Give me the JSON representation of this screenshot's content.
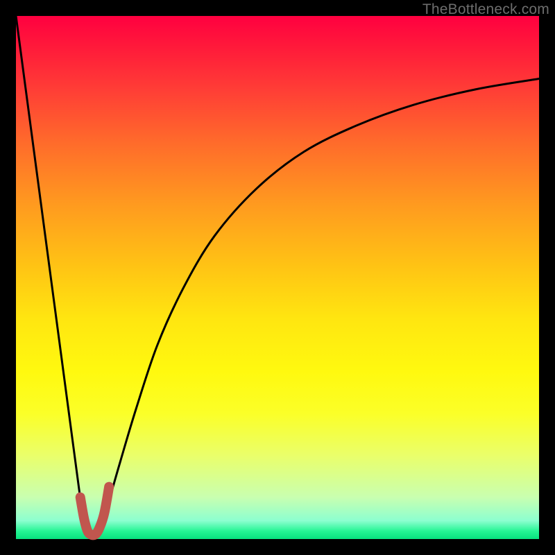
{
  "watermark": "TheBottleneck.com",
  "chart_data": {
    "type": "line",
    "title": "",
    "xlabel": "",
    "ylabel": "",
    "xlim": [
      0,
      100
    ],
    "ylim": [
      0,
      100
    ],
    "series": [
      {
        "name": "bottleneck-curve",
        "x": [
          0,
          12,
          13,
          14,
          15,
          16,
          17,
          18,
          20,
          23,
          27,
          32,
          38,
          46,
          55,
          65,
          76,
          88,
          100
        ],
        "values": [
          100,
          10,
          3,
          1,
          1,
          2,
          4,
          8,
          15,
          25,
          37,
          48,
          58,
          67,
          74,
          79,
          83,
          86,
          88
        ]
      },
      {
        "name": "recommended-range",
        "x": [
          12.3,
          13.0,
          13.7,
          14.5,
          15.3,
          16.0,
          16.9,
          17.8
        ],
        "values": [
          8.0,
          4.0,
          1.5,
          0.8,
          1.0,
          2.2,
          5.0,
          10.0
        ]
      }
    ],
    "colors": {
      "curve": "#000000",
      "highlight": "#c1564e",
      "gradient_top": "#ff0040",
      "gradient_bottom": "#07e27e"
    }
  }
}
